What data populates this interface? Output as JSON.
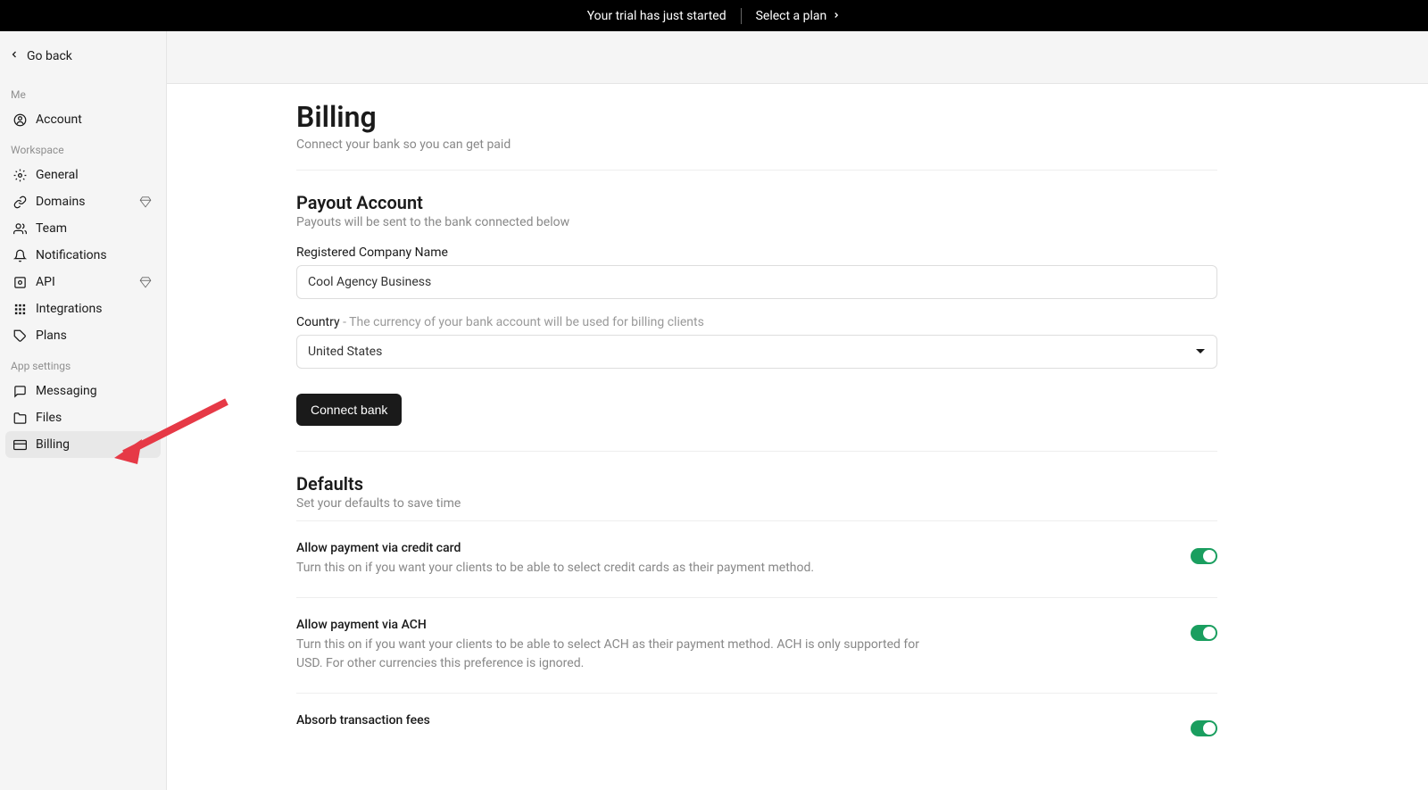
{
  "topbar": {
    "trial_text": "Your trial has just started",
    "select_plan_label": "Select a plan"
  },
  "sidebar": {
    "go_back": "Go back",
    "sections": {
      "me": {
        "label": "Me",
        "items": [
          {
            "label": "Account"
          }
        ]
      },
      "workspace": {
        "label": "Workspace",
        "items": [
          {
            "label": "General"
          },
          {
            "label": "Domains",
            "premium": true
          },
          {
            "label": "Team"
          },
          {
            "label": "Notifications"
          },
          {
            "label": "API",
            "premium": true
          },
          {
            "label": "Integrations"
          },
          {
            "label": "Plans"
          }
        ]
      },
      "app_settings": {
        "label": "App settings",
        "items": [
          {
            "label": "Messaging"
          },
          {
            "label": "Files"
          },
          {
            "label": "Billing",
            "active": true
          }
        ]
      }
    }
  },
  "page": {
    "title": "Billing",
    "subtitle": "Connect your bank so you can get paid"
  },
  "payout": {
    "title": "Payout Account",
    "subtitle": "Payouts will be sent to the bank connected below",
    "company_label": "Registered Company Name",
    "company_value": "Cool Agency Business",
    "country_label": "Country",
    "country_hint": " - The currency of your bank account will be used for billing clients",
    "country_value": "United States",
    "connect_button": "Connect bank"
  },
  "defaults": {
    "title": "Defaults",
    "subtitle": "Set your defaults to save time",
    "settings": [
      {
        "title": "Allow payment via credit card",
        "desc": "Turn this on if you want your clients to be able to select credit cards as their payment method.",
        "on": true
      },
      {
        "title": "Allow payment via ACH",
        "desc": "Turn this on if you want your clients to be able to select ACH as their payment method. ACH is only supported for USD. For other currencies this preference is ignored.",
        "on": true
      },
      {
        "title": "Absorb transaction fees",
        "desc": "",
        "on": true
      }
    ]
  }
}
